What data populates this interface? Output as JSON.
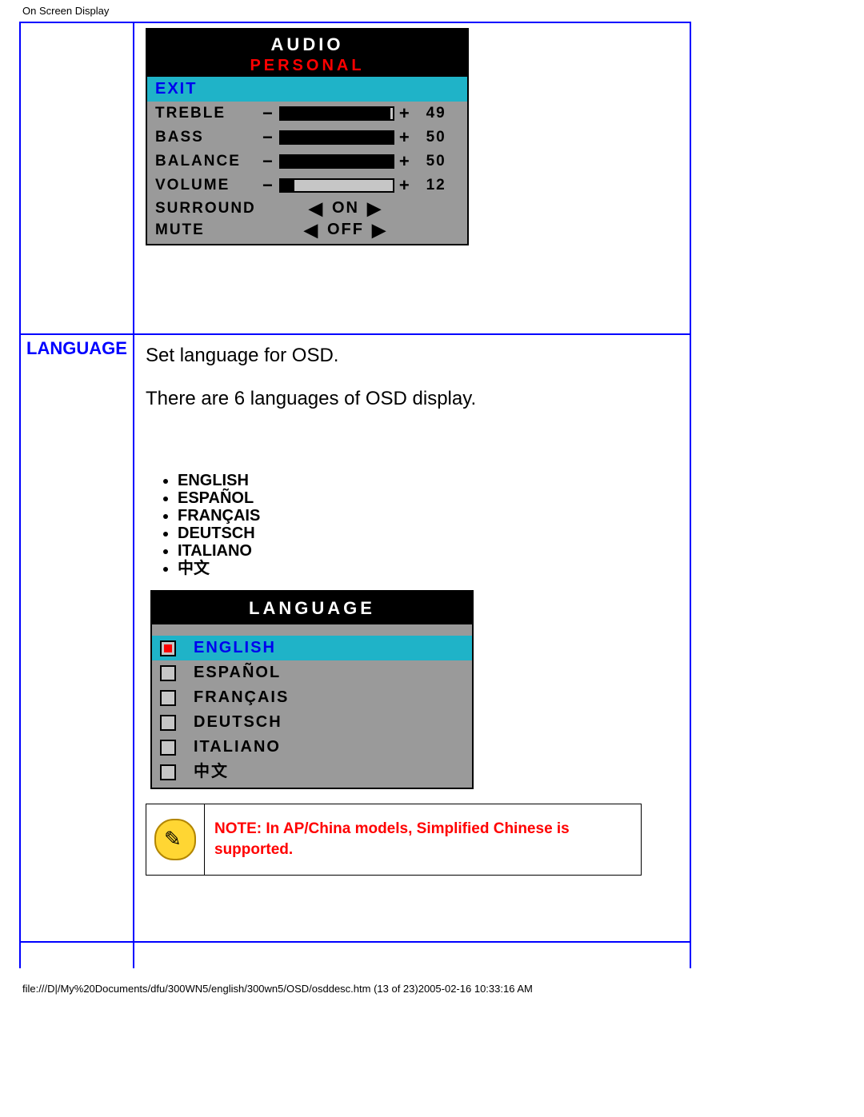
{
  "page": {
    "title": "On Screen Display",
    "footer": "file:///D|/My%20Documents/dfu/300WN5/english/300wn5/OSD/osddesc.htm (13 of 23)2005-02-16 10:33:16 AM"
  },
  "row1": {
    "left_label": "",
    "osd": {
      "title": "AUDIO",
      "subtitle": "PERSONAL",
      "exit": "EXIT",
      "sliders": [
        {
          "label": "TREBLE",
          "value": 49,
          "percent": 98
        },
        {
          "label": "BASS",
          "value": 50,
          "percent": 100
        },
        {
          "label": "BALANCE",
          "value": 50,
          "percent": 100
        },
        {
          "label": "VOLUME",
          "value": 12,
          "percent": 12
        }
      ],
      "toggles": [
        {
          "label": "SURROUND",
          "value": "ON"
        },
        {
          "label": "MUTE",
          "value": "OFF"
        }
      ],
      "minus": "−",
      "plus": "+",
      "left_arrow": "◀",
      "right_arrow": "▶"
    }
  },
  "row2": {
    "left_label": "LANGUAGE",
    "intro1": "Set language for OSD.",
    "intro2": "There are 6 languages of OSD display.",
    "bullets": [
      "ENGLISH",
      "ESPAÑOL",
      "FRANÇAIS",
      "DEUTSCH",
      "ITALIANO",
      "中文"
    ],
    "osd": {
      "title": "LANGUAGE",
      "items": [
        {
          "label": "ENGLISH",
          "selected": true
        },
        {
          "label": "ESPAÑOL",
          "selected": false
        },
        {
          "label": "FRANÇAIS",
          "selected": false
        },
        {
          "label": "DEUTSCH",
          "selected": false
        },
        {
          "label": "ITALIANO",
          "selected": false
        },
        {
          "label": "中文",
          "selected": false
        }
      ]
    },
    "note": "NOTE: In AP/China models, Simplified Chinese is supported."
  }
}
